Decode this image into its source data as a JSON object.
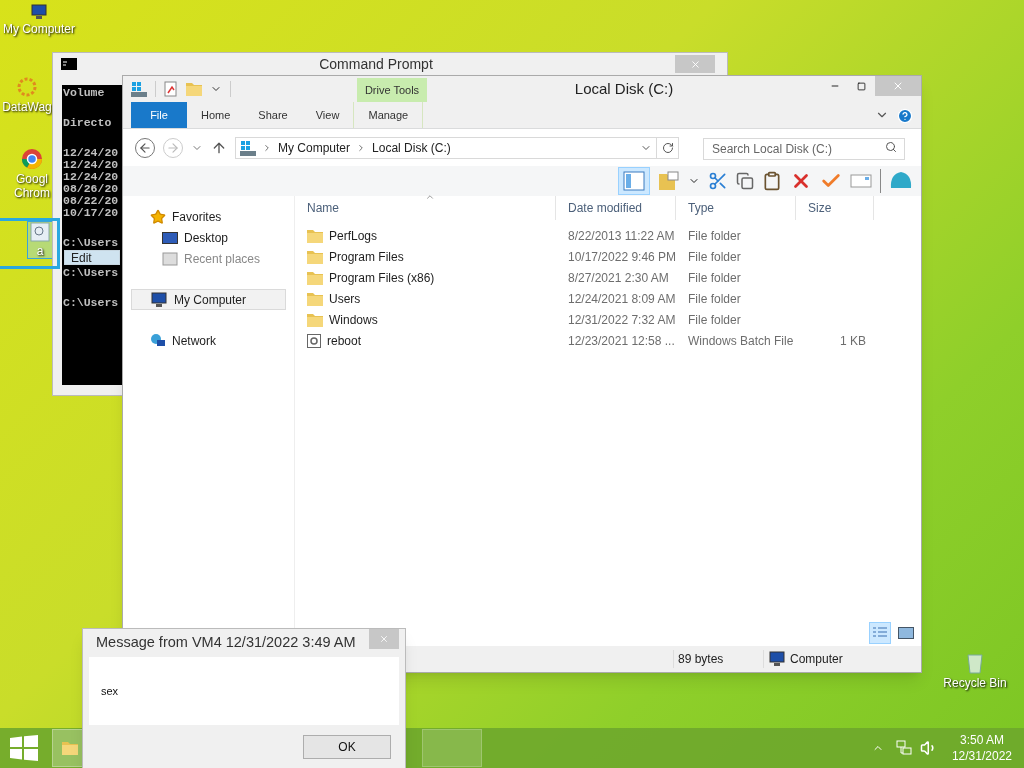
{
  "desktop_icons": [
    {
      "label": "My Computer",
      "kind": "computer",
      "selected": false
    },
    {
      "label": "DataWag",
      "kind": "app",
      "selected": false
    },
    {
      "label": "Googl Chrom",
      "kind": "browser",
      "selected": false
    },
    {
      "label": "a",
      "kind": "file",
      "selected": true
    },
    {
      "label": "Recycle Bin",
      "kind": "bin",
      "selected": false
    }
  ],
  "command_prompt": {
    "title": "Command Prompt",
    "blocks": [
      [
        "Volume"
      ],
      [
        "Directo"
      ],
      [
        "12/24/20",
        "12/24/20",
        "12/24/20",
        "08/26/20",
        "08/22/20",
        "10/17/20"
      ],
      [
        "C:\\Users"
      ],
      [
        "C:\\Users"
      ],
      [
        "C:\\Users"
      ]
    ]
  },
  "drag_ghost": {
    "label": "Edit"
  },
  "explorer": {
    "title": "Local Disk (C:)",
    "ribbon": {
      "context_label": "Drive Tools",
      "tabs": [
        {
          "label": "File",
          "kind": "file",
          "selected": false
        },
        {
          "label": "Home",
          "kind": "tab",
          "selected": false
        },
        {
          "label": "Share",
          "kind": "tab",
          "selected": false
        },
        {
          "label": "View",
          "kind": "tab",
          "selected": false
        },
        {
          "label": "Manage",
          "kind": "contextual",
          "selected": false
        }
      ]
    },
    "breadcrumb": [
      "My Computer",
      "Local Disk (C:)"
    ],
    "search": {
      "placeholder": "Search Local Disk (C:)"
    },
    "toolbar": {
      "preview_pane_on": true
    },
    "nav": [
      {
        "label": "Favorites",
        "kind": "favorites",
        "selected": false,
        "children": [
          {
            "label": "Desktop",
            "kind": "desktop",
            "selected": false
          },
          {
            "label": "Recent places",
            "kind": "recent",
            "selected": false
          }
        ]
      },
      {
        "label": "My Computer",
        "kind": "computer",
        "selected": true
      },
      {
        "label": "Network",
        "kind": "network",
        "selected": false
      }
    ],
    "columns": [
      {
        "label": "Name",
        "sorted": true
      },
      {
        "label": "Date modified",
        "sorted": false
      },
      {
        "label": "Type",
        "sorted": false
      },
      {
        "label": "Size",
        "sorted": false
      }
    ],
    "rows": [
      {
        "name": "PerfLogs",
        "date": "8/22/2013 11:22 AM",
        "type": "File folder",
        "kind": "folder"
      },
      {
        "name": "Program Files",
        "date": "10/17/2022 9:46 PM",
        "type": "File folder",
        "kind": "folder"
      },
      {
        "name": "Program Files (x86)",
        "date": "8/27/2021 2:30 AM",
        "type": "File folder",
        "kind": "folder"
      },
      {
        "name": "Users",
        "date": "12/24/2021 8:09 AM",
        "type": "File folder",
        "kind": "folder"
      },
      {
        "name": "Windows",
        "date": "12/31/2022 7:32 AM",
        "type": "File folder",
        "kind": "folder"
      },
      {
        "name": "reboot",
        "date": "12/23/2021 12:58 ...",
        "type": "Windows Batch File",
        "size": "1 KB",
        "kind": "batch"
      }
    ],
    "views": [
      {
        "kind": "details",
        "selected": true
      },
      {
        "kind": "large-icons",
        "selected": false
      }
    ],
    "status": {
      "size": "89 bytes",
      "zone": "Computer"
    }
  },
  "message": {
    "title": "Message from VM4 12/31/2022 3:49 AM",
    "text": "sex",
    "button": "OK"
  },
  "taskbar": {
    "time": "3:50 AM",
    "date": "12/31/2022"
  }
}
